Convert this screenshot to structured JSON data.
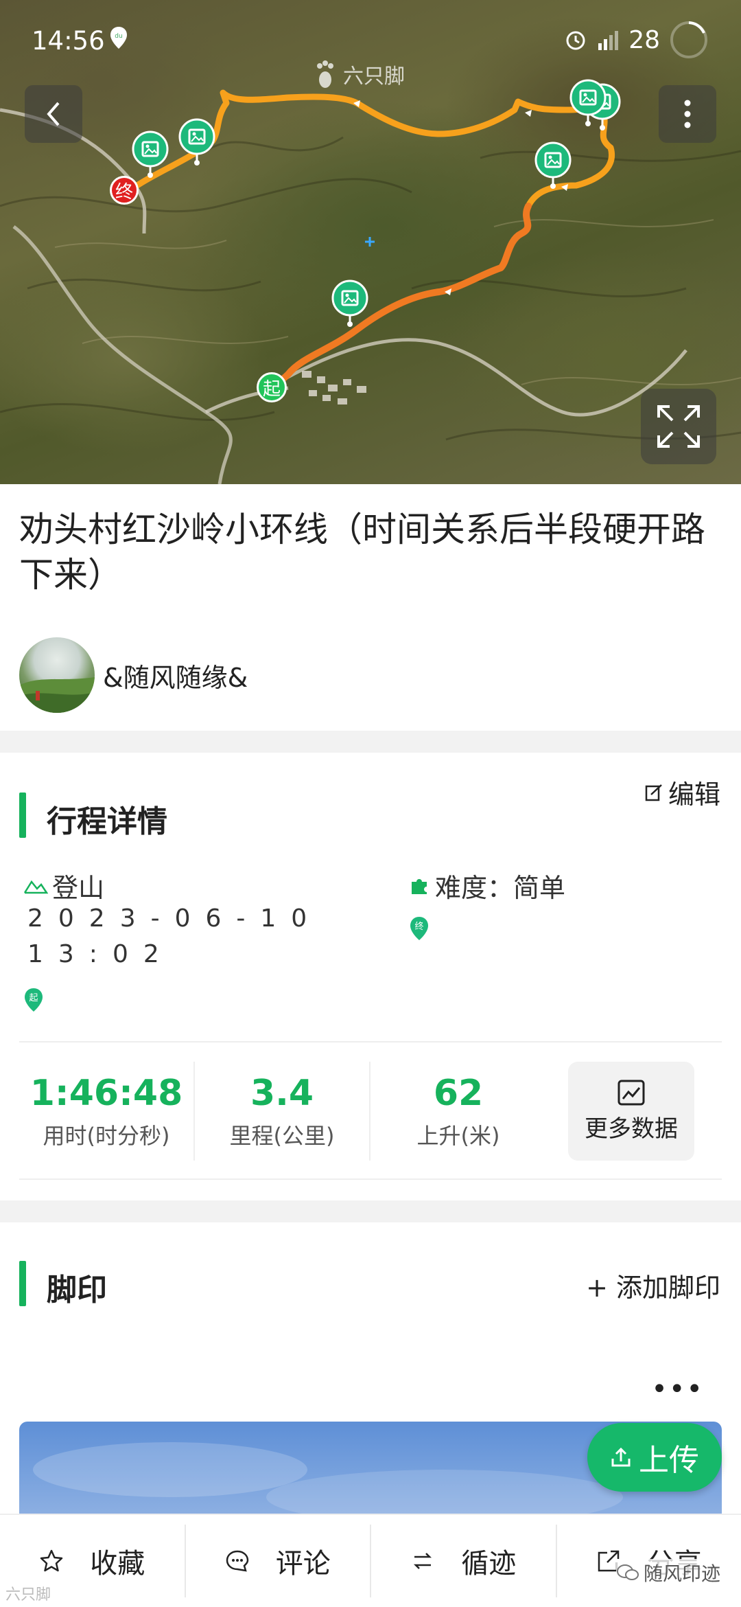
{
  "status_bar": {
    "time": "14:56",
    "battery": "28"
  },
  "map": {
    "watermark": "六只脚",
    "start_label": "起",
    "end_label": "终",
    "route_color": "#f07a22"
  },
  "trip": {
    "title": "劝头村红沙岭小环线（时间关系后半段硬开路下来）",
    "author": "&随风随缘&"
  },
  "details": {
    "section_title": "行程详情",
    "edit_label": "编辑",
    "activity": "登山",
    "difficulty": "难度：简单",
    "date_line1": "2023-06-10",
    "date_line2": "13:02",
    "start_pin": "起",
    "end_pin": "终",
    "stats": [
      {
        "value": "1:46:48",
        "label": "用时(时分秒)"
      },
      {
        "value": "3.4",
        "label": "里程(公里)"
      },
      {
        "value": "62",
        "label": "上升(米)"
      }
    ],
    "more_data_label": "更多数据"
  },
  "footprint": {
    "section_title": "脚印",
    "add_label": "+ 添加脚印",
    "more_dots": "•••",
    "upload_label": "上传"
  },
  "bottom_bar": {
    "items": [
      {
        "label": "收藏",
        "icon": "star-icon"
      },
      {
        "label": "评论",
        "icon": "comment-icon"
      },
      {
        "label": "循迹",
        "icon": "track-icon"
      },
      {
        "label": "分享",
        "icon": "share-icon"
      }
    ]
  },
  "watermarks": {
    "left": "六只脚",
    "right": "随风印迹"
  },
  "colors": {
    "accent": "#16b25c",
    "end_marker": "#e02020",
    "start_marker": "#22c45a"
  }
}
